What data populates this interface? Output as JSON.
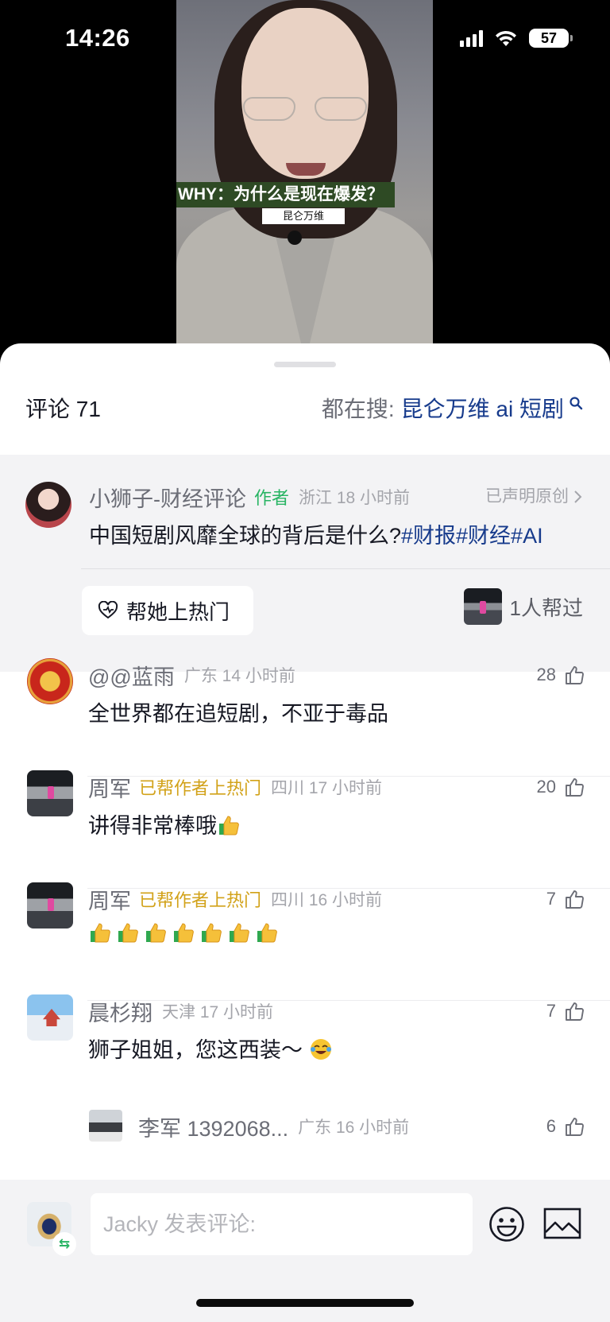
{
  "status_bar": {
    "time": "14:26",
    "battery": "57"
  },
  "video": {
    "caption_main": "WHY：为什么是现在爆发？",
    "caption_sub": "昆仑万维"
  },
  "comments_header": {
    "count_label": "评论 71",
    "search_prefix": "都在搜:",
    "search_term": "昆仑万维 ai 短剧",
    "search_icon": "search-icon"
  },
  "author_post": {
    "username": "小狮子-财经评论",
    "author_tag": "作者",
    "location_time": "浙江 18 小时前",
    "original_label": "已声明原创",
    "text_plain": "中国短剧风靡全球的背后是什么?",
    "hashtags": "#财报#财经#AI",
    "boost_button": "帮她上热门",
    "helped_label": "1人帮过"
  },
  "comments": [
    {
      "username": "@@蓝雨",
      "helped_tag": "",
      "location_time": "广东 14 小时前",
      "likes": "28",
      "text": "全世界都在追短剧，不亚于毒品",
      "emoji_count": 0
    },
    {
      "username": "周军",
      "helped_tag": "已帮作者上热门",
      "location_time": "四川 17 小时前",
      "likes": "20",
      "text": "讲得非常棒哦",
      "emoji_count": 1
    },
    {
      "username": "周军",
      "helped_tag": "已帮作者上热门",
      "location_time": "四川 16 小时前",
      "likes": "7",
      "text": "",
      "emoji_count": 7
    },
    {
      "username": "晨杉翔",
      "helped_tag": "",
      "location_time": "天津 17 小时前",
      "likes": "7",
      "text": "狮子姐姐，您这西装～",
      "emoji_count": 0
    }
  ],
  "reply": {
    "username": "李军 1392068...",
    "location_time": "广东 16 小时前",
    "likes": "6"
  },
  "input_bar": {
    "placeholder": "Jacky 发表评论:",
    "swap_glyph": "⇆",
    "emoji_icon": "emoji-icon",
    "image_icon": "image-icon"
  },
  "colors": {
    "link_blue": "#173b8c",
    "author_green": "#28b463",
    "helped_gold": "#d2a219",
    "muted_gray": "#a4a5ab"
  }
}
